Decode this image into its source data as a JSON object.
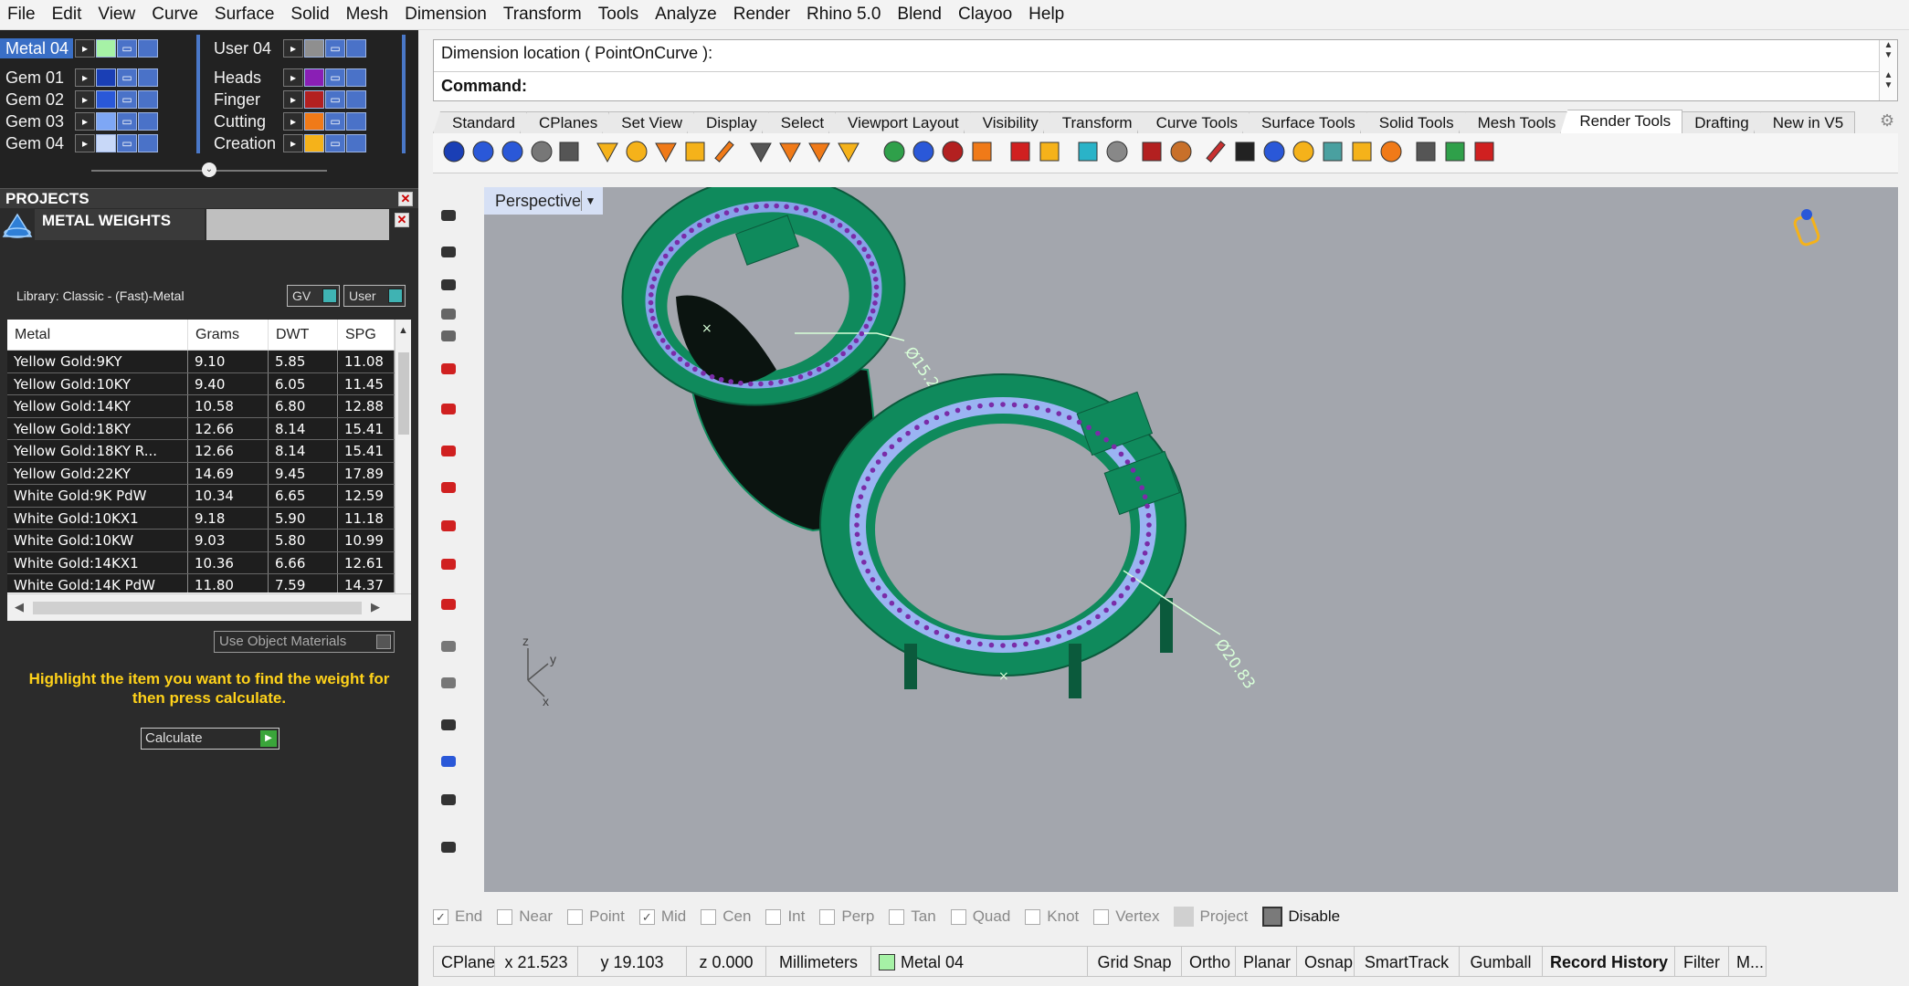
{
  "menu": [
    "File",
    "Edit",
    "View",
    "Curve",
    "Surface",
    "Solid",
    "Mesh",
    "Dimension",
    "Transform",
    "Tools",
    "Analyze",
    "Render",
    "Rhino 5.0",
    "Blend",
    "Clayoo",
    "Help"
  ],
  "layers": {
    "left": [
      {
        "name": "Metal 04",
        "color": "#a6f2a6",
        "selected": true
      },
      {
        "name": "Gem 01",
        "color": "#1a3fb5"
      },
      {
        "name": "Gem 02",
        "color": "#2a58d8"
      },
      {
        "name": "Gem 03",
        "color": "#7ea7f5"
      },
      {
        "name": "Gem 04",
        "color": "#c8d8f8"
      }
    ],
    "right": [
      {
        "name": "User 04",
        "color": "#8f8f8f"
      },
      {
        "name": "Heads",
        "color": "#8a1fb5"
      },
      {
        "name": "Finger",
        "color": "#b32020"
      },
      {
        "name": "Cutting",
        "color": "#f07a18"
      },
      {
        "name": "Creation",
        "color": "#f5b21a"
      }
    ]
  },
  "projects": {
    "title": "PROJECTS"
  },
  "metal_weights": {
    "title": "METAL WEIGHTS",
    "library": "Library: Classic - (Fast)-Metal",
    "gv_label": "GV",
    "user_label": "User",
    "columns": [
      "Metal",
      "Grams",
      "DWT",
      "SPG"
    ],
    "rows": [
      [
        "Yellow Gold:9KY",
        "9.10",
        "5.85",
        "11.08"
      ],
      [
        "Yellow Gold:10KY",
        "9.40",
        "6.05",
        "11.45"
      ],
      [
        "Yellow Gold:14KY",
        "10.58",
        "6.80",
        "12.88"
      ],
      [
        "Yellow Gold:18KY",
        "12.66",
        "8.14",
        "15.41"
      ],
      [
        "Yellow Gold:18KY R...",
        "12.66",
        "8.14",
        "15.41"
      ],
      [
        "Yellow Gold:22KY",
        "14.69",
        "9.45",
        "17.89"
      ],
      [
        "White Gold:9K PdW",
        "10.34",
        "6.65",
        "12.59"
      ],
      [
        "White Gold:10KX1",
        "9.18",
        "5.90",
        "11.18"
      ],
      [
        "White Gold:10KW",
        "9.03",
        "5.80",
        "10.99"
      ],
      [
        "White Gold:14KX1",
        "10.36",
        "6.66",
        "12.61"
      ],
      [
        "White Gold:14K PdW",
        "11.80",
        "7.59",
        "14.37"
      ]
    ],
    "use_object_materials": "Use Object Materials",
    "hint": "Highlight the item you want to find the weight for then press calculate.",
    "calculate": "Calculate"
  },
  "command": {
    "line1": "Dimension location ( PointOnCurve ):",
    "line2": "Command:"
  },
  "tabs": [
    "Standard",
    "CPlanes",
    "Set View",
    "Display",
    "Select",
    "Viewport Layout",
    "Visibility",
    "Transform",
    "Curve Tools",
    "Surface Tools",
    "Solid Tools",
    "Mesh Tools",
    "Render Tools",
    "Drafting",
    "New in V5"
  ],
  "active_tab": "Render Tools",
  "viewport": {
    "name": "Perspective",
    "dim1": "Ø15.28",
    "dim2": "Ø20.83",
    "axis_y": "y",
    "axis_z": "z",
    "axis_x": "x"
  },
  "osnap": {
    "items": [
      {
        "label": "End",
        "checked": true
      },
      {
        "label": "Near",
        "checked": false
      },
      {
        "label": "Point",
        "checked": false
      },
      {
        "label": "Mid",
        "checked": true
      },
      {
        "label": "Cen",
        "checked": false
      },
      {
        "label": "Int",
        "checked": false
      },
      {
        "label": "Perp",
        "checked": false
      },
      {
        "label": "Tan",
        "checked": false
      },
      {
        "label": "Quad",
        "checked": false
      },
      {
        "label": "Knot",
        "checked": false
      },
      {
        "label": "Vertex",
        "checked": false
      }
    ],
    "project": "Project",
    "disable": "Disable"
  },
  "status": {
    "cplane": "CPlane",
    "x": "x 21.523",
    "y": "y 19.103",
    "z": "z 0.000",
    "units": "Millimeters",
    "layer": "Metal 04",
    "grid_snap": "Grid Snap",
    "ortho": "Ortho",
    "planar": "Planar",
    "osnap": "Osnap",
    "smarttrack": "SmartTrack",
    "gumball": "Gumball",
    "record_history": "Record History",
    "filter": "Filter",
    "more": "M..."
  },
  "colors": {
    "ring": "#0f8a5c",
    "ring_dark": "#064d33",
    "gems": "#9ab4f2",
    "prongs": "#7a2ca8",
    "viewport_bg": "#a3a6ad",
    "hint": "#ffd21a"
  }
}
